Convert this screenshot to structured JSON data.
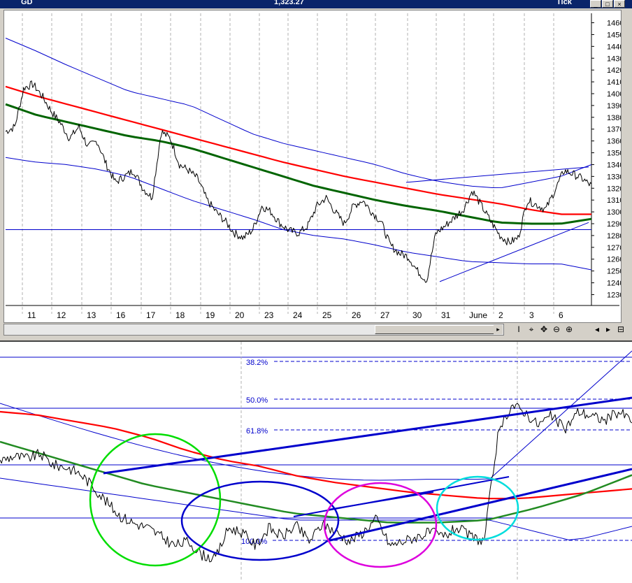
{
  "window": {
    "symbol": "GD",
    "price": "1,323.27",
    "interval": "Tick",
    "buttons": [
      "_",
      "□",
      "×"
    ]
  },
  "toolbar": {
    "tools": [
      "I",
      "⌖",
      "✥",
      "⊖",
      "⊕",
      "◂",
      "▸",
      "⊟"
    ]
  },
  "chart_data": [
    {
      "type": "line",
      "title": "",
      "y_ticks": [
        1230,
        1240,
        1250,
        1260,
        1270,
        1280,
        1290,
        1300,
        1310,
        1320,
        1330,
        1340,
        1350,
        1360,
        1370,
        1380,
        1390,
        1400,
        1410,
        1420,
        1430,
        1440,
        1450,
        1460
      ],
      "ylim": [
        1222,
        1468
      ],
      "x_labels": [
        "11",
        "12",
        "13",
        "16",
        "17",
        "18",
        "19",
        "20",
        "23",
        "24",
        "25",
        "26",
        "27",
        "30",
        "31",
        "June",
        "2",
        "3",
        "6"
      ],
      "grid": "dashed vertical at session boundaries",
      "colors": {
        "price": "#000000",
        "ma_red": "#ff0000",
        "ma_green": "#006400",
        "bands": "#0000cc",
        "trendlines": "#0000cc"
      },
      "horizontal_line": 1285,
      "series": [
        {
          "role": "price",
          "values": [
            1368,
            1372,
            1405,
            1408,
            1398,
            1385,
            1375,
            1362,
            1372,
            1355,
            1360,
            1340,
            1325,
            1330,
            1335,
            1320,
            1312,
            1368,
            1362,
            1340,
            1335,
            1328,
            1310,
            1300,
            1292,
            1282,
            1278,
            1285,
            1305,
            1300,
            1290,
            1284,
            1282,
            1288,
            1305,
            1312,
            1300,
            1290,
            1305,
            1310,
            1300,
            1292,
            1272,
            1265,
            1262,
            1250,
            1242,
            1282,
            1288,
            1295,
            1302,
            1318,
            1305,
            1292,
            1280,
            1274,
            1278,
            1310,
            1306,
            1302,
            1318,
            1335,
            1332,
            1328,
            1322
          ]
        },
        {
          "role": "ma_red",
          "values": [
            1406,
            1398,
            1391,
            1384,
            1377,
            1370,
            1363,
            1356,
            1349,
            1342,
            1336,
            1330,
            1325,
            1320,
            1315,
            1311,
            1307,
            1302,
            1298,
            1298
          ]
        },
        {
          "role": "ma_green",
          "values": [
            1391,
            1382,
            1376,
            1370,
            1364,
            1360,
            1354,
            1346,
            1338,
            1330,
            1322,
            1316,
            1310,
            1305,
            1301,
            1296,
            1291,
            1290,
            1290,
            1294
          ]
        },
        {
          "role": "band_upper",
          "values": [
            1447,
            1436,
            1424,
            1413,
            1402,
            1396,
            1390,
            1378,
            1366,
            1358,
            1352,
            1346,
            1340,
            1332,
            1326,
            1322,
            1320,
            1325,
            1330,
            1340
          ]
        },
        {
          "role": "band_lower",
          "values": [
            1346,
            1342,
            1340,
            1336,
            1330,
            1320,
            1310,
            1302,
            1294,
            1285,
            1280,
            1277,
            1272,
            1266,
            1262,
            1258,
            1257,
            1256,
            1256,
            1251
          ]
        }
      ]
    },
    {
      "type": "line",
      "title": "",
      "fib_levels": [
        {
          "label": "38.2%",
          "value": 38.2
        },
        {
          "label": "50.0%",
          "value": 50.0
        },
        {
          "label": "61.8%",
          "value": 61.8
        },
        {
          "label": "100.0%",
          "value": 100.0
        }
      ],
      "annotation_circle_colors": [
        "#00dd00",
        "#0000cc",
        "#dd00dd",
        "#00dddd"
      ],
      "colors": {
        "price": "#000000",
        "ma_red": "#ff0000",
        "ma_green": "#228b22",
        "bands": "#0000cc"
      },
      "series": [
        {
          "role": "price",
          "values": [
            1300,
            1302,
            1301,
            1303,
            1298,
            1297,
            1294,
            1288,
            1281,
            1275,
            1272,
            1270,
            1266,
            1262,
            1264,
            1258,
            1256,
            1270,
            1268,
            1262,
            1270,
            1266,
            1271,
            1264,
            1272,
            1268,
            1264,
            1268,
            1274,
            1262,
            1264,
            1266,
            1268,
            1266,
            1270,
            1266,
            1264,
            1310,
            1325,
            1322,
            1316,
            1320,
            1314,
            1322,
            1320,
            1318,
            1322,
            1318
          ]
        },
        {
          "role": "ma_red",
          "values": [
            1330,
            1328,
            1324,
            1320,
            1314,
            1306,
            1300,
            1296,
            1290,
            1286,
            1283,
            1280,
            1278,
            1276,
            1276,
            1278,
            1280,
            1282
          ]
        },
        {
          "role": "ma_green",
          "values": [
            1304,
            1298,
            1292,
            1286,
            1282,
            1278,
            1274,
            1272,
            1270,
            1270,
            1271,
            1276,
            1282,
            1290
          ]
        }
      ]
    }
  ]
}
